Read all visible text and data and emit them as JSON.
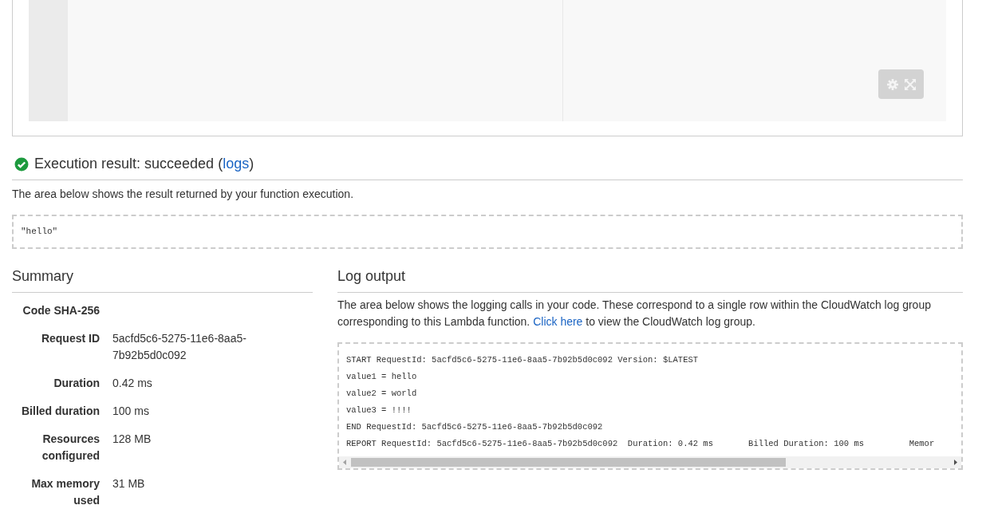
{
  "result": {
    "kind": "success",
    "heading": "Execution result: succeeded (",
    "link": "logs",
    "heading_end": ")",
    "description": "The area below shows the result returned by your function execution.",
    "output": "\"hello\""
  },
  "summary": {
    "title": "Summary",
    "rows": [
      {
        "label": "Code SHA-256"
      },
      {
        "label": "Request ID",
        "value": "5acfd5c6-5275-11e6-8aa5-7b92b5d0c092"
      },
      {
        "label": "Duration",
        "value": "0.42 ms"
      },
      {
        "label": "Billed duration",
        "value": "100 ms"
      },
      {
        "label": "Resources configured",
        "value": "128 MB"
      },
      {
        "label": "Max memory used",
        "value": "31 MB"
      }
    ]
  },
  "log_output": {
    "title": "Log output",
    "description_before": "The area below shows the logging calls in your code. These correspond to a single row within the CloudWatch log group corresponding to this Lambda function. ",
    "link": "Click here",
    "description_after": " to view the CloudWatch log group.",
    "lines": [
      "START RequestId: 5acfd5c6-5275-11e6-8aa5-7b92b5d0c092 Version: $LATEST",
      "value1 = hello",
      "value2 = world",
      "value3 = !!!!",
      "END RequestId: 5acfd5c6-5275-11e6-8aa5-7b92b5d0c092",
      "REPORT RequestId: 5acfd5c6-5275-11e6-8aa5-7b92b5d0c092  Duration: 0.42 ms       Billed Duration: 100 ms         Memor"
    ]
  }
}
